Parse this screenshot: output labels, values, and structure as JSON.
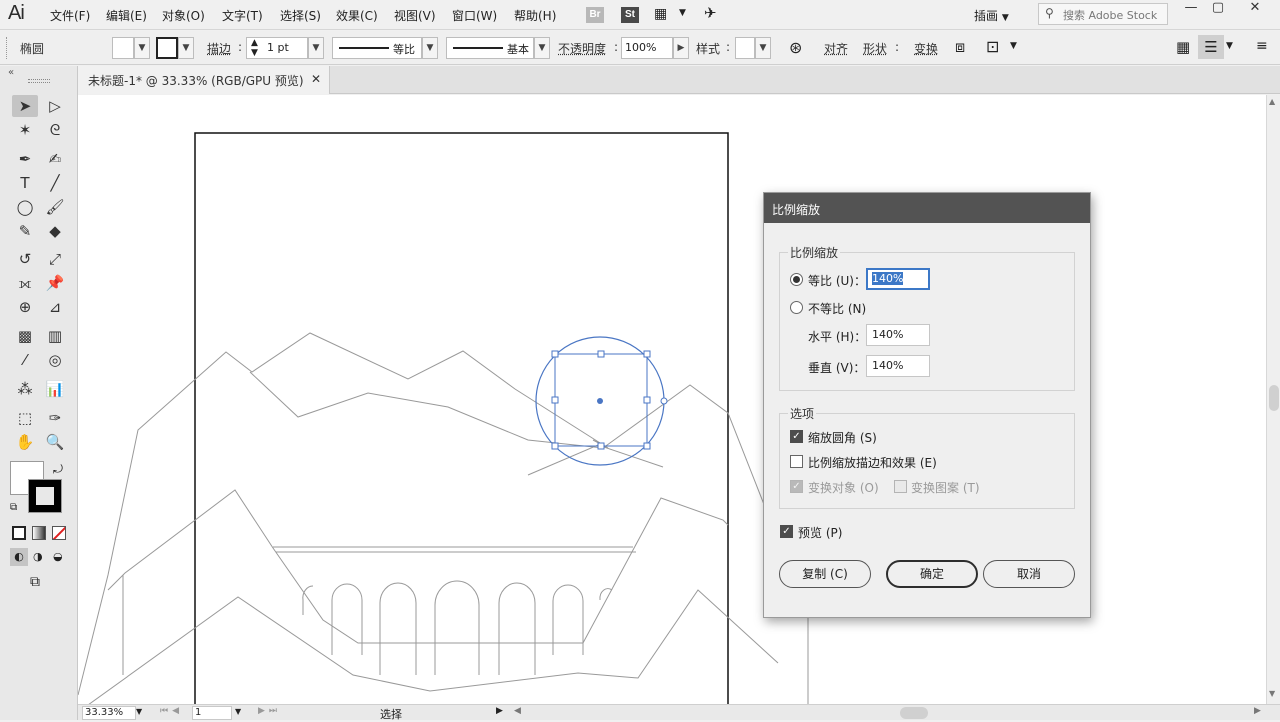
{
  "app": {
    "logo": "Ai",
    "workspace": "插画",
    "search_placeholder": "搜索 Adobe Stock"
  },
  "menu": {
    "items": [
      "文件(F)",
      "编辑(E)",
      "对象(O)",
      "文字(T)",
      "选择(S)",
      "效果(C)",
      "视图(V)",
      "窗口(W)",
      "帮助(H)"
    ]
  },
  "toolbar_badges": {
    "br": "Br",
    "st": "St"
  },
  "window_controls": {
    "minimize": "—",
    "maximize": "▢",
    "close": "✕"
  },
  "control": {
    "object_type": "椭圆",
    "stroke_label": "描边",
    "stroke_weight": "1 pt",
    "profile_label": "等比",
    "brush_label": "基本",
    "opacity_label": "不透明度",
    "opacity_value": "100%",
    "style_label": "样式",
    "align_label": "对齐",
    "shape_label": "形状",
    "transform_label": "变换"
  },
  "tab": {
    "title": "未标题-1* @ 33.33% (RGB/GPU 预览)",
    "close": "✕"
  },
  "status": {
    "zoom": "33.33%",
    "artboard": "1",
    "tool": "选择"
  },
  "dialog": {
    "title": "比例缩放",
    "group_scale": "比例缩放",
    "uniform_label": "等比 (U)：",
    "uniform_value": "140%",
    "nonuniform_label": "不等比 (N)",
    "horizontal_label": "水平 (H)：",
    "horizontal_value": "140%",
    "vertical_label": "垂直 (V)：",
    "vertical_value": "140%",
    "group_options": "选项",
    "scale_corners": "缩放圆角 (S)",
    "scale_strokes": "比例缩放描边和效果 (E)",
    "transform_objects": "变换对象 (O)",
    "transform_patterns": "变换图案 (T)",
    "preview": "预览 (P)",
    "copy_button": "复制 (C)",
    "ok_button": "确定",
    "cancel_button": "取消"
  },
  "colors": {
    "selection": "#4a76c4",
    "dialog_title_bg": "#535353",
    "brand_orange": "#f08a1a"
  }
}
